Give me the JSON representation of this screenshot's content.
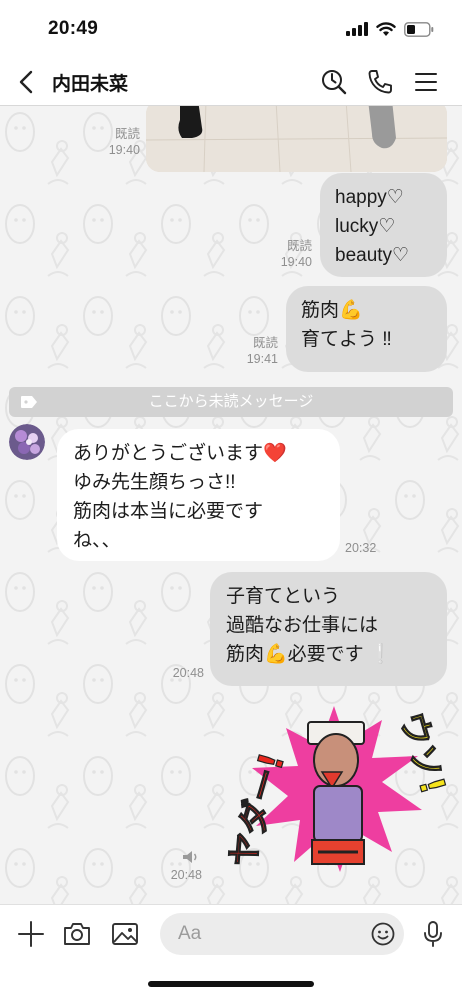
{
  "status": {
    "time": "20:49"
  },
  "header": {
    "contact_name": "内田未菜"
  },
  "messages": {
    "photo": {
      "read": "既読",
      "time": "19:40"
    },
    "m1": {
      "lines": [
        "happy♡",
        "lucky♡",
        "beauty♡"
      ],
      "read": "既読",
      "time": "19:40"
    },
    "m2": {
      "lines": [
        "筋肉💪",
        "育てよう ‼"
      ],
      "read": "既読",
      "time": "19:41"
    },
    "unread_divider": "ここから未読メッセージ",
    "m3": {
      "lines": [
        "ありがとうございます❤️",
        "ゆみ先生顔ちっさ!!",
        "筋肉は本当に必要です",
        "ね、、"
      ],
      "time": "20:32"
    },
    "m4": {
      "lines": [
        "子育てという",
        "過酷なお仕事には",
        "筋肉💪必要です ❕"
      ],
      "time": "20:48"
    },
    "sticker": {
      "time": "20:48",
      "text_left": "ヤダー!",
      "text_right": "ウソ!"
    }
  },
  "input": {
    "placeholder": "Aa"
  },
  "colors": {
    "bubble_self": "#dcdcdc",
    "bubble_other": "#ffffff",
    "chat_bg": "#f3f3f3"
  }
}
